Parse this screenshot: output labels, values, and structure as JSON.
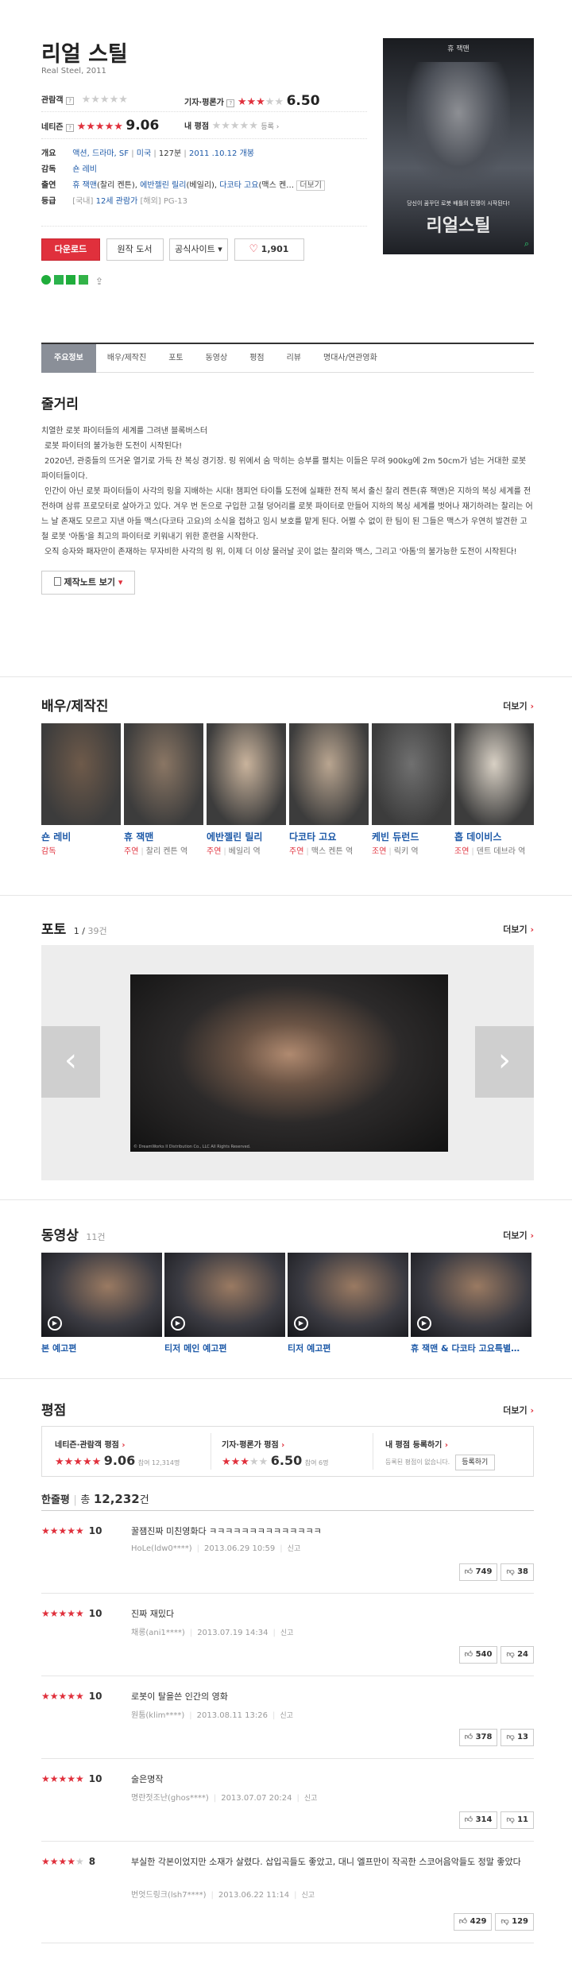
{
  "movie": {
    "title": "리얼 스틸",
    "subtitle": "Real Steel, 2011",
    "poster_top_text": "휴 잭맨",
    "poster_tagline": "당신이 꿈꾸던 로봇 배틀의 전쟁이 시작된다!",
    "poster_title": "리얼스틸"
  },
  "ratings": {
    "audience_label": "관람객",
    "audience_stars": 0,
    "critic_label": "기자·평론가",
    "critic_stars": 3.25,
    "critic_score": "6.50",
    "netizen_label": "네티즌",
    "netizen_stars": 4.5,
    "netizen_score": "9.06",
    "my_label": "내 평점",
    "my_stars": 0,
    "register_label": "등록"
  },
  "info": {
    "genre_label": "개요",
    "genre": "액션, 드라마, SF",
    "country": "미국",
    "runtime": "127분",
    "release": "2011 .10.12 개봉",
    "director_label": "감독",
    "director": "숀 레비",
    "cast_label": "출연",
    "cast_a": "휴 잭맨",
    "cast_a_role": "(찰리 켄튼)",
    "cast_b": "에반젤린 릴리",
    "cast_b_role": "(베일리)",
    "cast_c": "다코타 고요",
    "cast_c_role": "(맥스 켄…",
    "cast_more": "더보기",
    "grade_label": "등급",
    "grade_pre": "[국내]",
    "grade_value": "12세 관람가",
    "grade_mid": "[해외]",
    "grade_foreign": "PG-13"
  },
  "buttons": {
    "download": "다운로드",
    "original": "원작 도서",
    "official": "공식사이트",
    "like_count": "1,901"
  },
  "tabs": [
    "주요정보",
    "배우/제작진",
    "포토",
    "동영상",
    "평점",
    "리뷰",
    "명대사/연관영화"
  ],
  "synopsis": {
    "title": "줄거리",
    "p1": "치열한 로봇 파이터들의 세계를 그려낸 블록버스터",
    "p2": "로봇 파이터의 불가능한 도전이 시작된다!",
    "p3": "2020년, 관중들의 뜨거운 열기로 가득 찬 복싱 경기장. 링 위에서 숨 막히는 승부를 펼치는 이들은 무려 900kg에 2m 50cm가 넘는 거대한 로봇 파이터들이다.",
    "p4": "인간이 아닌 로봇 파이터들이 사각의 링을 지배하는 시대! 챔피언 타이틀 도전에 실패한 전직 복서 출신 찰리 켄튼(휴 잭맨)은 지하의 복싱 세계를 전전하며 삼류 프로모터로 살아가고 있다. 겨우 번 돈으로 구입한 고철 덩어리를 로봇 파이터로 만들어 지하의 복싱 세계를 벗어나 재기하려는 찰리는 어느 날 존재도 모르고 지낸 아들 맥스(다코타 고요)의 소식을 접하고 임시 보호를 맡게 된다. 어쩔 수 없이 한 팀이 된 그들은 맥스가 우연히 발견한 고철 로봇 '아톰'을 최고의 파이터로 키워내기 위한 훈련을 시작한다.",
    "p5": "오직 승자와 패자만이 존재하는 무자비한 사각의 링 위, 이제 더 이상 물러날 곳이 없는 찰리와 맥스, 그리고 '아톰'의 불가능한 도전이 시작된다!",
    "note_button": "제작노트 보기"
  },
  "cast_section": {
    "title": "배우/제작진",
    "more": "더보기",
    "people": [
      {
        "name": "숀 레비",
        "role": "감독",
        "character": ""
      },
      {
        "name": "휴 잭맨",
        "role": "주연",
        "character": "찰리 켄튼 역"
      },
      {
        "name": "에반젤린 릴리",
        "role": "주연",
        "character": "베일리 역"
      },
      {
        "name": "다코타 고요",
        "role": "주연",
        "character": "맥스 켄튼 역"
      },
      {
        "name": "케빈 듀런드",
        "role": "조연",
        "character": "릭키 역"
      },
      {
        "name": "홉 데이비스",
        "role": "조연",
        "character": "덴트 데브라 역"
      }
    ]
  },
  "photo_section": {
    "title": "포토",
    "current": "1",
    "total": "39건",
    "more": "더보기",
    "caption": "© DreamWorks II Distribution Co., LLC All Rights Reserved."
  },
  "video_section": {
    "title": "동영상",
    "count": "11건",
    "more": "더보기",
    "videos": [
      "본 예고편",
      "티저 메인 예고편",
      "티저 예고편",
      "휴 잭맨 & 다코타 고요특별…"
    ]
  },
  "review_section": {
    "title": "평점",
    "more": "더보기",
    "netizen_box_label": "네티즌·관람객 평점",
    "netizen_box_score": "9.06",
    "netizen_box_count": "참여 12,314명",
    "critic_box_label": "기자·평론가 평점",
    "critic_box_score": "6.50",
    "critic_box_count": "참여 6명",
    "my_box_label": "내 평점 등록하기",
    "my_box_sub": "등록된 평점이 없습니다.",
    "my_box_button": "등록하기",
    "short_label": "한줄평",
    "total_prefix": "총",
    "total_count": "12,232",
    "total_suffix": "건",
    "items": [
      {
        "stars": 5,
        "score": "10",
        "text": "꿀잼진짜 미친영화다 ㅋㅋㅋㅋㅋㅋㅋㅋㅋㅋㅋㅋㅋㅋ",
        "user": "HoLe(ldw0****)",
        "date": "2013.06.29 10:59",
        "report": "신고",
        "up": "749",
        "down": "38"
      },
      {
        "stars": 5,
        "score": "10",
        "text": "진짜 재밌다",
        "user": "채롱(ani1****)",
        "date": "2013.07.19 14:34",
        "report": "신고",
        "up": "540",
        "down": "24"
      },
      {
        "stars": 5,
        "score": "10",
        "text": "로봇이 탈을쓴 인간의 영화",
        "user": "원툼(klim****)",
        "date": "2013.08.11 13:26",
        "report": "신고",
        "up": "378",
        "down": "13"
      },
      {
        "stars": 5,
        "score": "10",
        "text": "술은명작",
        "user": "명란젓조난(ghos****)",
        "date": "2013.07.07 20:24",
        "report": "신고",
        "up": "314",
        "down": "11"
      },
      {
        "stars": 4,
        "score": "8",
        "text": "부실한 각본이었지만 소재가 살렸다. 삽입곡들도 좋았고, 대니 엘프만이 작곡한 스코어음악들도 정말 좋았다",
        "user": "번엇드링크(lsh7****)",
        "date": "2013.06.22 11:14",
        "report": "신고",
        "up": "429",
        "down": "129"
      }
    ]
  },
  "colors": {
    "accent": "#e0303c",
    "link": "#1e5aa8",
    "tab_active": "#8a8f98"
  }
}
